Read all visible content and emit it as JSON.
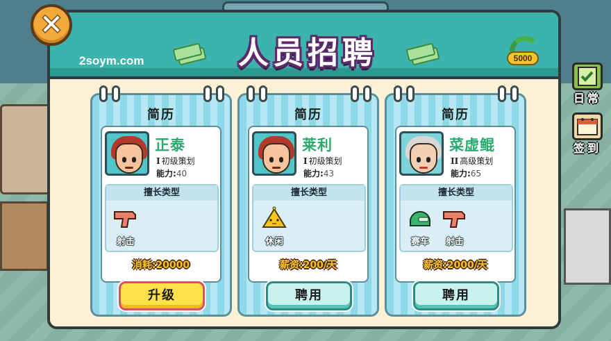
{
  "header": {
    "title": "人员招聘",
    "watermark": "2soym.com",
    "coin_amount": "5000"
  },
  "side_menu": [
    {
      "label": "日常",
      "icon": "clipboard-icon"
    },
    {
      "label": "签到",
      "icon": "calendar-icon"
    }
  ],
  "cards": [
    {
      "title": "简历",
      "name": "正泰",
      "rank_numeral": "I",
      "rank": "初级策划",
      "ability_label": "能力:",
      "ability_value": "40",
      "skills_title": "擅长类型",
      "skills": [
        {
          "label": "射击",
          "icon": "gun-icon"
        }
      ],
      "cost_text": "消耗:20000",
      "button_label": "升级",
      "button_type": "upgrade",
      "hair_color": "#b23a2c"
    },
    {
      "title": "简历",
      "name": "莱利",
      "rank_numeral": "I",
      "rank": "初级策划",
      "ability_label": "能力:",
      "ability_value": "43",
      "skills_title": "擅长类型",
      "skills": [
        {
          "label": "休闲",
          "icon": "chick-icon"
        }
      ],
      "cost_text": "薪资:200/天",
      "button_label": "聘用",
      "button_type": "hire",
      "hair_color": "#b23a2c"
    },
    {
      "title": "简历",
      "name": "菜虚鲲",
      "rank_numeral": "II",
      "rank": "高级策划",
      "ability_label": "能力:",
      "ability_value": "65",
      "skills_title": "擅长类型",
      "skills": [
        {
          "label": "赛车",
          "icon": "helmet-icon"
        },
        {
          "label": "射击",
          "icon": "gun-icon"
        }
      ],
      "cost_text": "薪资:2000/天",
      "button_label": "聘用",
      "button_type": "hire",
      "hair_color": "#d7d7d7"
    }
  ]
}
